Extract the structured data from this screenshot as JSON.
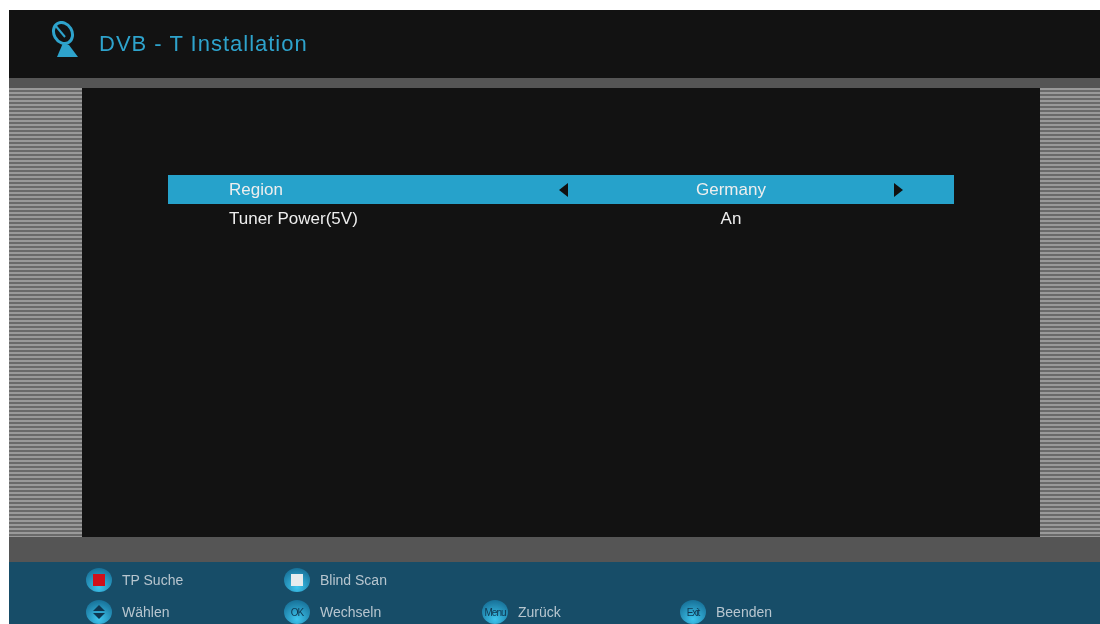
{
  "header": {
    "title": "DVB - T Installation"
  },
  "settings": [
    {
      "label": "Region",
      "value": "Germany",
      "selected": true
    },
    {
      "label": "Tuner Power(5V)",
      "value": "An",
      "selected": false
    }
  ],
  "footer": {
    "rows": [
      [
        {
          "kind": "red",
          "label": "TP Suche"
        },
        {
          "kind": "white",
          "label": "Blind Scan"
        }
      ],
      [
        {
          "kind": "updown",
          "label": "Wählen"
        },
        {
          "kind": "text",
          "key": "OK",
          "label": "Wechseln"
        },
        {
          "kind": "text",
          "key": "Menu",
          "label": "Zurück"
        },
        {
          "kind": "text",
          "key": "Exit",
          "label": "Beenden"
        }
      ]
    ]
  }
}
